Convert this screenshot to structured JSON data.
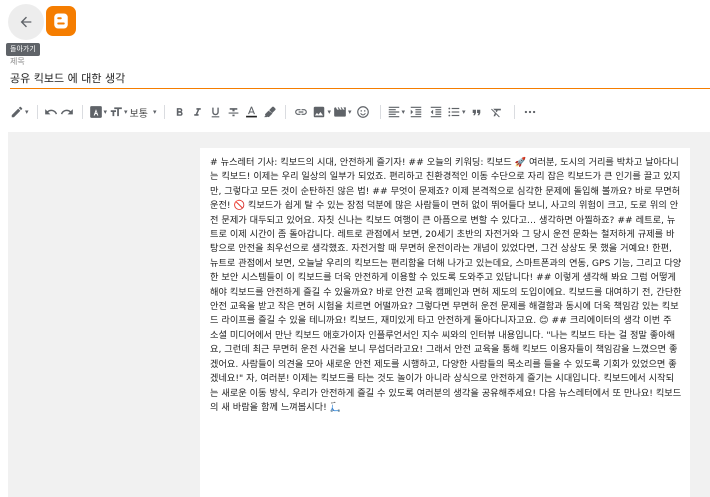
{
  "header": {
    "back_tooltip": "돌아가기"
  },
  "title": {
    "label": "제목",
    "value": "공유 킥보드 에 대한 생각"
  },
  "toolbar": {
    "font_size_label": "보통"
  },
  "post": {
    "body": "# 뉴스레터 기사: 킥보드의 시대, 안전하게 즐기자! ## 오늘의 키워딩: 킥보드 🚀 여러분, 도시의 거리를 박차고 날아다니는 킥보드! 이제는 우리 일상의 일부가 되었죠. 편리하고 친환경적인 이동 수단으로 자리 잡은 킥보드가 큰 인기를 끌고 있지만, 그렇다고 모든 것이 순탄하진 않은 법! ## 무엇이 문제죠? 이제 본격적으로 심각한 문제에 돌입해 볼까요? 바로 무면허 운전! 🚫 킥보드가 쉽게 탈 수 있는 장점 덕분에 많은 사람들이 면허 없이 뛰어들다 보니, 사고의 위험이 크고, 도로 위의 안전 문제가 대두되고 있어요. 자칫 신나는 킥보드 여행이 큰 아픔으로 변할 수 있다고… 생각하면 아찔하죠? ## 레트로, 뉴트로 이제 시간이 좀 돌아갑니다. 레트로 관점에서 보면, 20세기 초반의 자전거와 그 당시 운전 문화는 철저하게 규제를 바탕으로 안전을 최우선으로 생각했죠. 자전거할 때 무면허 운전이라는 개념이 있었다면, 그건 상상도 못 했을 거예요! 한편, 뉴트로 관점에서 보면, 오늘날 우리의 킥보드는 편리함을 더해 나가고 있는데요, 스마트폰과의 연동, GPS 기능, 그리고 다양한 보안 시스템들이 이 킥보드를 더욱 안전하게 이용할 수 있도록 도와주고 있답니다! ## 이렇게 생각해 봐요 그럼 어떻게 해야 킥보드를 안전하게 즐길 수 있을까요? 바로 안전 교육 캠페인과 면허 제도의 도입이에요. 킥보드를 대여하기 전, 간단한 안전 교육을 받고 작은 면허 시험을 치르면 어떨까요? 그렇다면 무면허 운전 문제를 해결함과 동시에 더욱 책임감 있는 킥보드 라이프를 즐길 수 있을 테니까요! 킥보드, 재미있게 타고 안전하게 돌아다니자고요. 😊 ## 크리에이터의 생각 이번 주 소셜 미디어에서 만난 킥보드 애호가이자 인플루언서인 지수 씨와의 인터뷰 내용입니다. \"나는 킥보드 타는 걸 정말 좋아해요, 그런데 최근 무면허 운전 사건을 보니 무섭더라고요! 그래서 안전 교육을 통해 킥보드 이용자들이 책임감을 느꼈으면 좋겠어요. 사람들이 의견을 모아 새로운 안전 제도를 시행하고, 다양한 사람들의 목소리를 들을 수 있도록 기회가 있었으면 좋겠네요!\" 자, 여러분! 이제는 킥보드를 타는 것도 놀이가 아니라 상식으로 안전하게 즐기는 시대입니다. 킥보드에서 시작되는 새로운 이동 방식, 우리가 안전하게 즐길 수 있도록 여러분의 생각을 공유해주세요! 다음 뉴스레터에서 또 만나요! 킥보드의 새 바람을 함께 느껴봅시다! 🛴"
  },
  "colors": {
    "accent": "#f57d00",
    "editor_background": "#f1f1f1"
  }
}
